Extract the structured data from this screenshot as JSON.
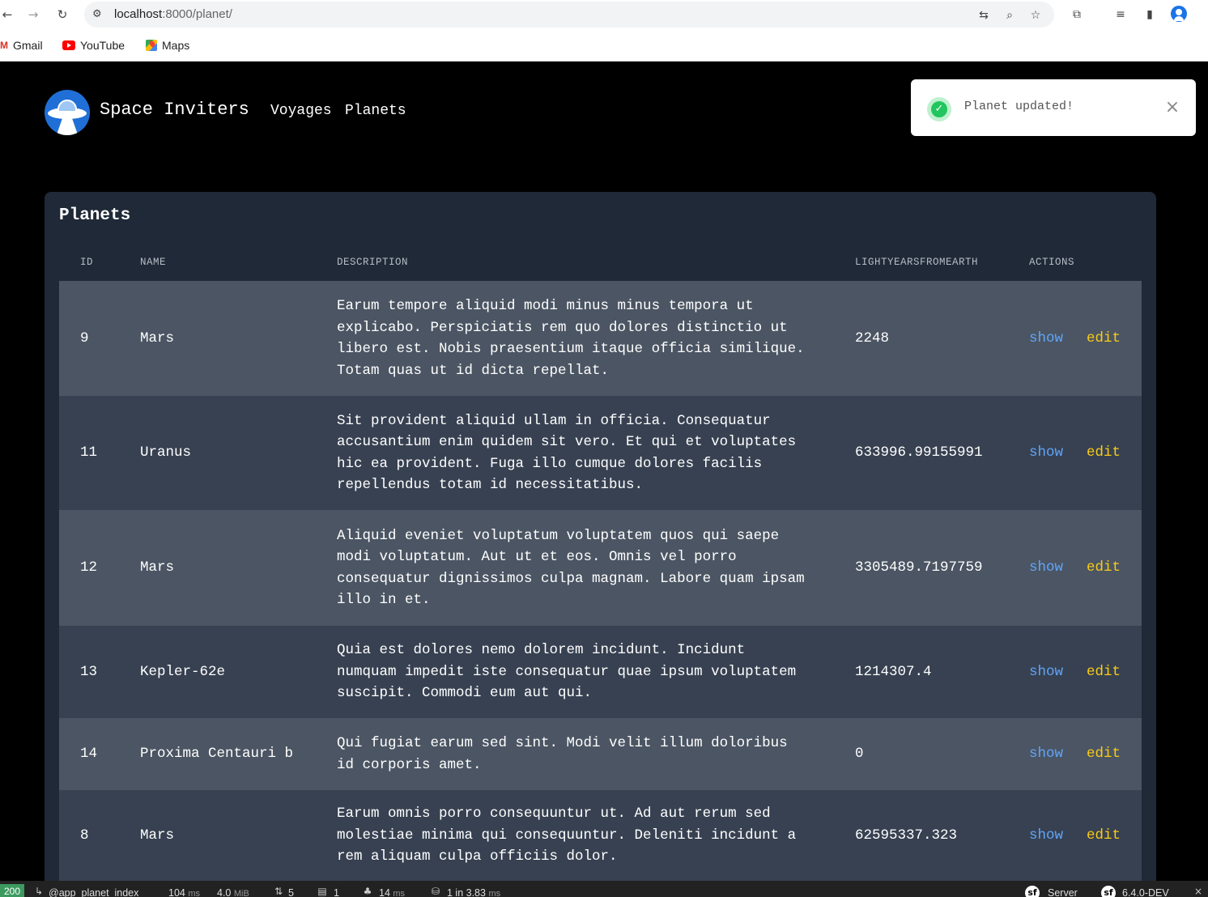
{
  "browser": {
    "url_host": "localhost",
    "url_rest": ":8000/planet/",
    "bookmarks": [
      {
        "label": "Gmail",
        "icon": "gmail-icon"
      },
      {
        "label": "YouTube",
        "icon": "youtube-icon"
      },
      {
        "label": "Maps",
        "icon": "maps-icon"
      }
    ]
  },
  "app": {
    "brand": "Space Inviters",
    "nav": [
      "Voyages",
      "Planets"
    ],
    "toast": {
      "message": "Planet updated!",
      "icon": "check-circle-icon",
      "close_icon": "close-icon"
    },
    "panel_title": "Planets",
    "columns": [
      "ID",
      "NAME",
      "DESCRIPTION",
      "LIGHTYEARSFROMEARTH",
      "ACTIONS"
    ],
    "actions": {
      "show": "show",
      "edit": "edit"
    },
    "rows": [
      {
        "id": "9",
        "name": "Mars",
        "description": [
          "Earum tempore aliquid modi minus minus tempora ut",
          "explicabo. Perspiciatis rem quo dolores distinctio ut",
          "libero est. Nobis praesentium itaque officia similique.",
          "Totam quas ut id dicta repellat."
        ],
        "ly": "2248"
      },
      {
        "id": "11",
        "name": "Uranus",
        "description": [
          "Sit provident aliquid ullam in officia. Consequatur",
          "accusantium enim quidem sit vero. Et qui et voluptates",
          "hic ea provident. Fuga illo cumque dolores facilis",
          "repellendus totam id necessitatibus."
        ],
        "ly": "633996.99155991"
      },
      {
        "id": "12",
        "name": "Mars",
        "description": [
          "Aliquid eveniet voluptatum voluptatem quos qui saepe",
          "modi voluptatum. Aut ut et eos. Omnis vel porro",
          "consequatur dignissimos culpa magnam. Labore quam ipsam",
          "illo in et."
        ],
        "ly": "3305489.7197759"
      },
      {
        "id": "13",
        "name": "Kepler-62e",
        "description": [
          "Quia est dolores nemo dolorem incidunt. Incidunt",
          "numquam impedit iste consequatur quae ipsum voluptatem",
          "suscipit. Commodi eum aut qui."
        ],
        "ly": "1214307.4"
      },
      {
        "id": "14",
        "name": "Proxima Centauri b",
        "description": [
          "Qui fugiat earum sed sint. Modi velit illum doloribus",
          "id corporis amet."
        ],
        "ly": "0"
      },
      {
        "id": "8",
        "name": "Mars",
        "description": [
          "Earum omnis porro consequuntur ut. Ad aut rerum sed",
          "molestiae minima qui consequuntur. Deleniti incidunt a",
          "rem aliquam culpa officiis dolor."
        ],
        "ly": "62595337.323"
      }
    ]
  },
  "debug_toolbar": {
    "status": "200",
    "route": "@app_planet_index",
    "time": "104",
    "time_unit": "ms",
    "memory": "4.0",
    "memory_unit": "MiB",
    "requests": "5",
    "forms": "1",
    "twig": "14",
    "twig_unit": "ms",
    "db": "1 in 3.83",
    "db_unit": "ms",
    "server": "Server",
    "version": "6.4.0-DEV"
  }
}
